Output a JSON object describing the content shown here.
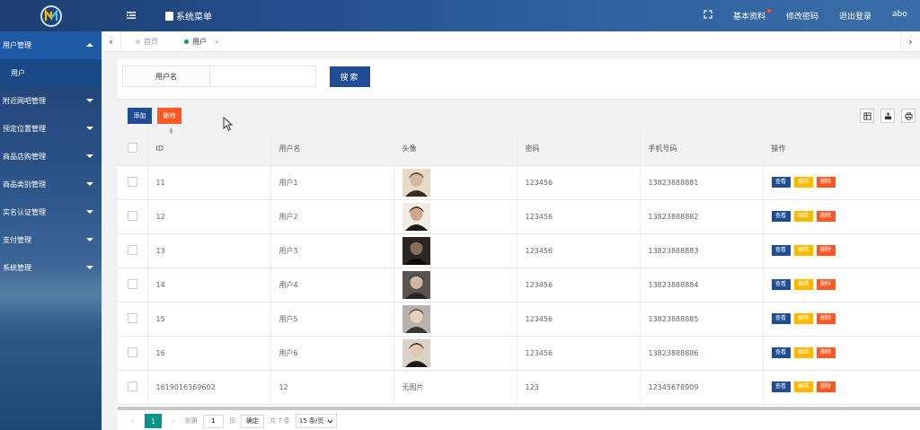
{
  "header": {
    "title": "系统菜单",
    "right_items": [
      "基本资料",
      "修改密码",
      "退出登录",
      "abo"
    ]
  },
  "sidebar": {
    "items": [
      {
        "label": "用户管理",
        "expanded": true,
        "children": [
          "用户"
        ]
      },
      {
        "label": "附近网吧管理"
      },
      {
        "label": "预定位置管理"
      },
      {
        "label": "商品店购管理"
      },
      {
        "label": "商品类别管理"
      },
      {
        "label": "实名认证管理"
      },
      {
        "label": "支付管理"
      },
      {
        "label": "系统管理"
      }
    ]
  },
  "tabs": [
    {
      "label": "首页",
      "active": false
    },
    {
      "label": "用户",
      "active": true,
      "close": "×"
    }
  ],
  "search": {
    "label": "用户名",
    "value": "",
    "button": "搜索"
  },
  "toolbar": {
    "add": "添加",
    "delete": "删除"
  },
  "table": {
    "columns": [
      "ID",
      "用户名",
      "头像",
      "密码",
      "手机号码",
      "操作"
    ],
    "actions": {
      "view": "查看",
      "edit": "编辑",
      "delete": "删除"
    },
    "rows": [
      {
        "id": "11",
        "username": "用户1",
        "avatar": "image",
        "password": "123456",
        "phone": "13823888881"
      },
      {
        "id": "12",
        "username": "用户2",
        "avatar": "image",
        "password": "123456",
        "phone": "13823888882"
      },
      {
        "id": "13",
        "username": "用户3",
        "avatar": "image",
        "password": "123456",
        "phone": "13823888883"
      },
      {
        "id": "14",
        "username": "用户4",
        "avatar": "image",
        "password": "123456",
        "phone": "13823888884"
      },
      {
        "id": "15",
        "username": "用户5",
        "avatar": "image",
        "password": "123456",
        "phone": "13823888885"
      },
      {
        "id": "16",
        "username": "用户6",
        "avatar": "image",
        "password": "123456",
        "phone": "13823888886"
      },
      {
        "id": "1619016369602",
        "username": "12",
        "avatar": "无图片",
        "password": "123",
        "phone": "12345678909"
      }
    ]
  },
  "pager": {
    "current": "1",
    "goto_label": "到第",
    "goto_value": "1",
    "page_unit": "页",
    "ok": "确定",
    "total": "共 7 条",
    "page_size": "15 条/页"
  },
  "colors": {
    "primary": "#1e4d96",
    "warn": "#ffb800",
    "danger": "#ff5722",
    "teal": "#009688"
  }
}
